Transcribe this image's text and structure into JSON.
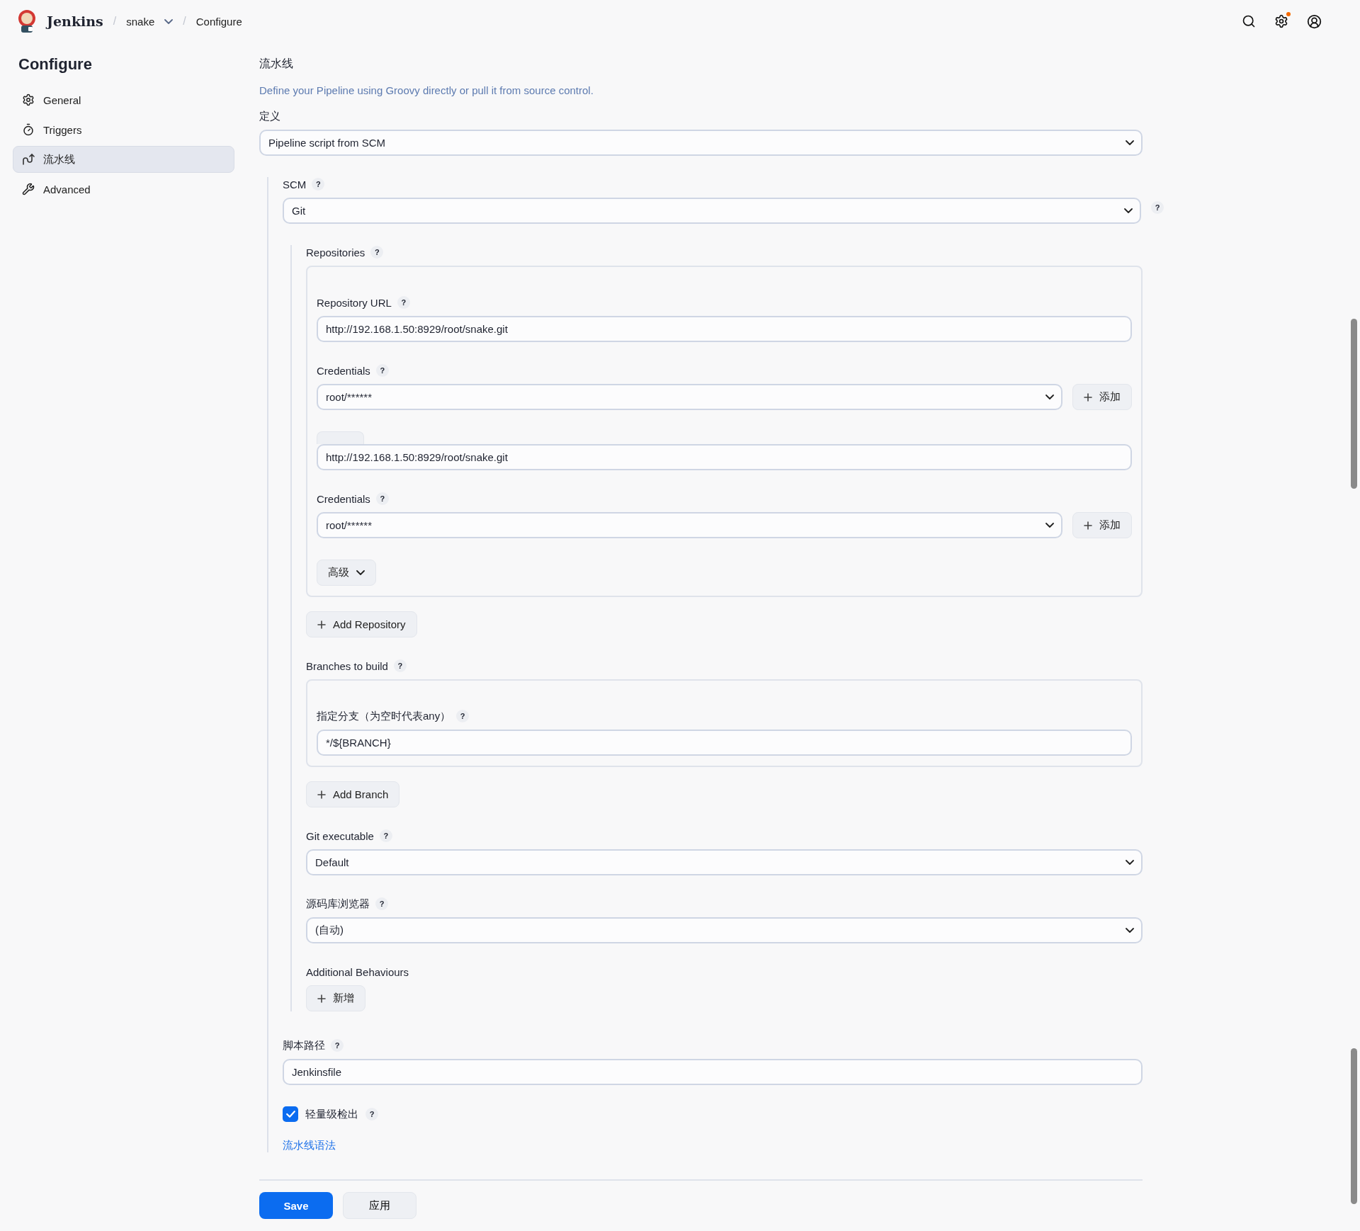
{
  "header": {
    "brand": "Jenkins",
    "breadcrumbs": [
      {
        "separator": "/",
        "label": "snake",
        "dropdown": true
      },
      {
        "separator": "/",
        "label": "Configure"
      }
    ],
    "settings_alert": true
  },
  "sidebar": {
    "title": "Configure",
    "items": [
      {
        "label": "General",
        "kind": "gear",
        "selected": false
      },
      {
        "label": "Triggers",
        "kind": "clock",
        "selected": false
      },
      {
        "label": "流水线",
        "kind": "pipeline",
        "selected": true
      },
      {
        "label": "Advanced",
        "kind": "wrench",
        "selected": false
      }
    ]
  },
  "section": {
    "title": "流水线",
    "description": "Define your Pipeline using Groovy directly or pull it from source control.",
    "definition": {
      "label": "定义",
      "value": "Pipeline script from SCM"
    },
    "scm": {
      "label": "SCM",
      "help": "?",
      "value": "Git",
      "side_help": "?",
      "repositories": {
        "label": "Repositories",
        "help": "?",
        "entries": [
          {
            "kind": "overlapped",
            "url_label": "Repository URL",
            "url_help": "?",
            "url": "http://192.168.1.50:8929/root/snake.git",
            "credentials_label": "Credentials",
            "credentials_help": "?",
            "credentials": "root/******",
            "add_button": "添加"
          },
          {
            "kind": "full",
            "url": "http://192.168.1.50:8929/root/snake.git",
            "credentials_label": "Credentials",
            "credentials_help": "?",
            "credentials": "root/******",
            "add_button": "添加",
            "advanced_button": "高级"
          }
        ],
        "add_button": "Add Repository"
      },
      "branches": {
        "label": "Branches to build",
        "help": "?",
        "spec_label": "指定分支（为空时代表any）",
        "spec_help": "?",
        "spec": "*/${BRANCH}",
        "add_button": "Add Branch"
      },
      "git_executable": {
        "label": "Git executable",
        "help": "?",
        "value": "Default"
      },
      "browser": {
        "label": "源码库浏览器",
        "help": "?",
        "value": "(自动)"
      },
      "behaviours": {
        "label": "Additional Behaviours",
        "add_button": "新增"
      }
    },
    "script_path": {
      "label": "脚本路径",
      "help": "?",
      "value": "Jenkinsfile"
    },
    "lightweight": {
      "label": "轻量级检出",
      "help": "?",
      "checked": true
    },
    "syntax_link": "流水线语法"
  },
  "buttons": {
    "save": "Save",
    "apply": "应用"
  }
}
